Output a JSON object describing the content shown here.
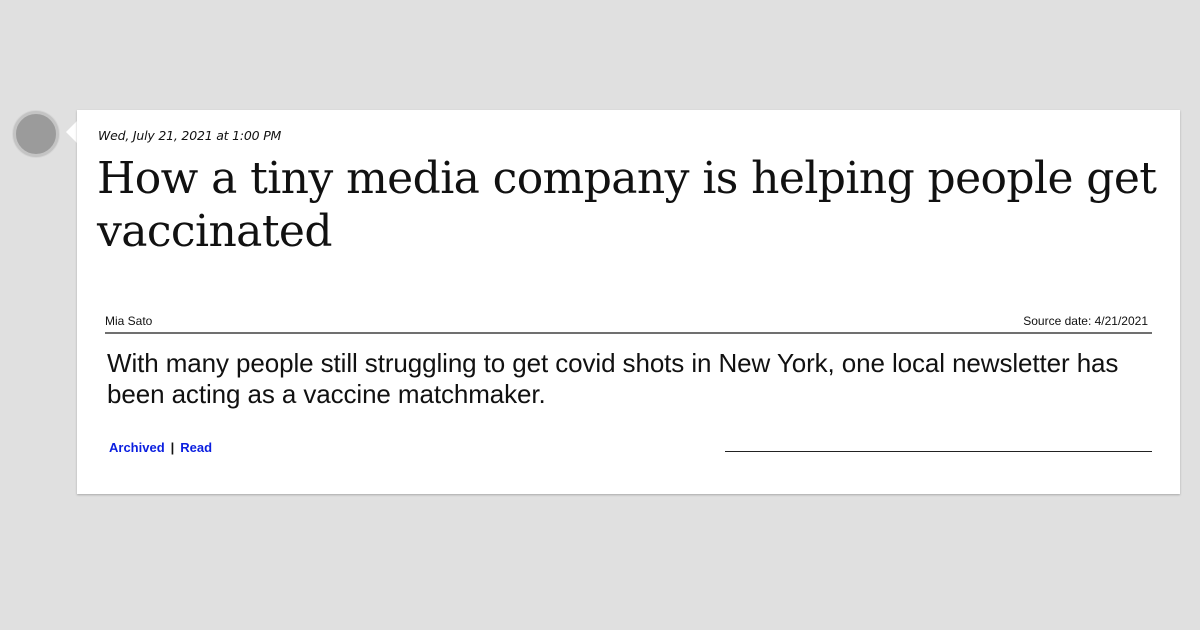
{
  "post": {
    "timestamp": "Wed, July 21, 2021 at 1:00 PM",
    "headline": "How a tiny media company is helping people get vaccinated",
    "author": "Mia Sato",
    "source_date": "Source date: 4/21/2021",
    "summary": "With many people still struggling to get covid shots in New York, one local newsletter has been acting as a vaccine matchmaker.",
    "links": {
      "archived": "Archived",
      "separator": "|",
      "read": "Read"
    }
  },
  "colors": {
    "background": "#e0e0e0",
    "card": "#ffffff",
    "link": "#0a1ee0",
    "avatar": "#9b9b9b"
  }
}
